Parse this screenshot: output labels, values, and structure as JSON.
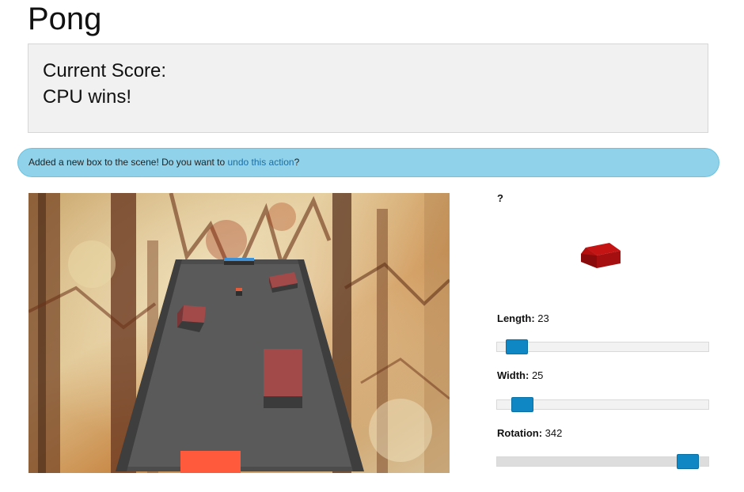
{
  "header": {
    "title": "Pong"
  },
  "score": {
    "label": "Current Score:",
    "value": "CPU wins!"
  },
  "notification": {
    "text_before": "Added a new box to the scene! Do you want to ",
    "link_text": "undo this action",
    "text_after": "?"
  },
  "scene": {
    "background": "autumn-forest-image",
    "board_color": "#5a5a5a",
    "paddle_color": "#ff5a3c",
    "cpu_paddle_color": "#3d8fd6",
    "box_color": "#a24a4a"
  },
  "panel": {
    "help": "?",
    "preview": {
      "shape": "box",
      "color": "#b30d0d"
    },
    "controls": [
      {
        "label": "Length:",
        "value": "23",
        "level": 0.045
      },
      {
        "label": "Width:",
        "value": "25",
        "level": 0.075
      },
      {
        "label": "Rotation:",
        "value": "342",
        "level": 0.95
      }
    ]
  }
}
